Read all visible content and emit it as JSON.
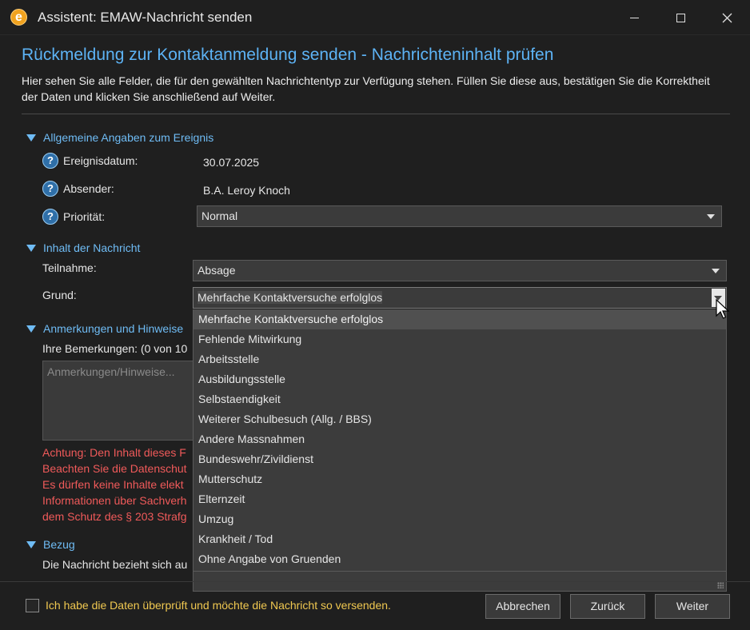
{
  "window": {
    "title": "Assistent: EMAW-Nachricht senden",
    "app_icon_letter": "e"
  },
  "header": {
    "heading": "Rückmeldung zur Kontaktanmeldung senden - Nachrichteninhalt prüfen",
    "intro": "Hier sehen Sie alle Felder, die für den gewählten Nachrichtentyp zur Verfügung stehen. Füllen Sie diese aus, bestätigen Sie die Korrektheit der Daten und klicken Sie anschließend auf Weiter."
  },
  "sections": {
    "general": {
      "title": "Allgemeine Angaben zum Ereignis",
      "event_date_label": "Ereignisdatum:",
      "event_date_value": "30.07.2025",
      "sender_label": "Absender:",
      "sender_value": "B.A. Leroy Knoch",
      "priority_label": "Priorität:",
      "priority_value": "Normal"
    },
    "content": {
      "title": "Inhalt der Nachricht",
      "participation_label": "Teilnahme:",
      "participation_value": "Absage",
      "reason_label": "Grund:",
      "reason_value": "Mehrfache Kontaktversuche erfolglos"
    },
    "notes": {
      "title": "Anmerkungen und Hinweise",
      "remarks_label": "Ihre Bemerkungen: (0 von 10",
      "placeholder": "Anmerkungen/Hinweise...",
      "warning_lines": [
        "Achtung: Den Inhalt dieses F",
        "Beachten Sie die Datenschut",
        "Es dürfen keine Inhalte elekt",
        "Informationen über Sachverh",
        "dem Schutz des § 203 Strafg"
      ]
    },
    "reference": {
      "title": "Bezug",
      "text": "Die Nachricht bezieht sich au"
    }
  },
  "dropdown": {
    "options": [
      "Mehrfache Kontaktversuche erfolglos",
      "Fehlende Mitwirkung",
      "Arbeitsstelle",
      "Ausbildungsstelle",
      "Selbstaendigkeit",
      "Weiterer Schulbesuch (Allg. / BBS)",
      "Andere Massnahmen",
      "Bundeswehr/Zivildienst",
      "Mutterschutz",
      "Elternzeit",
      "Umzug",
      "Krankheit / Tod",
      "Ohne Angabe von Gruenden"
    ]
  },
  "footer": {
    "confirm_label": "Ich habe die Daten überprüft und möchte die Nachricht so versenden.",
    "cancel_label": "Abbrechen",
    "back_label": "Zurück",
    "next_label": "Weiter"
  },
  "colors": {
    "accent": "#5db3f5",
    "warning": "#f05a5a",
    "confirm_text": "#f0c850"
  }
}
